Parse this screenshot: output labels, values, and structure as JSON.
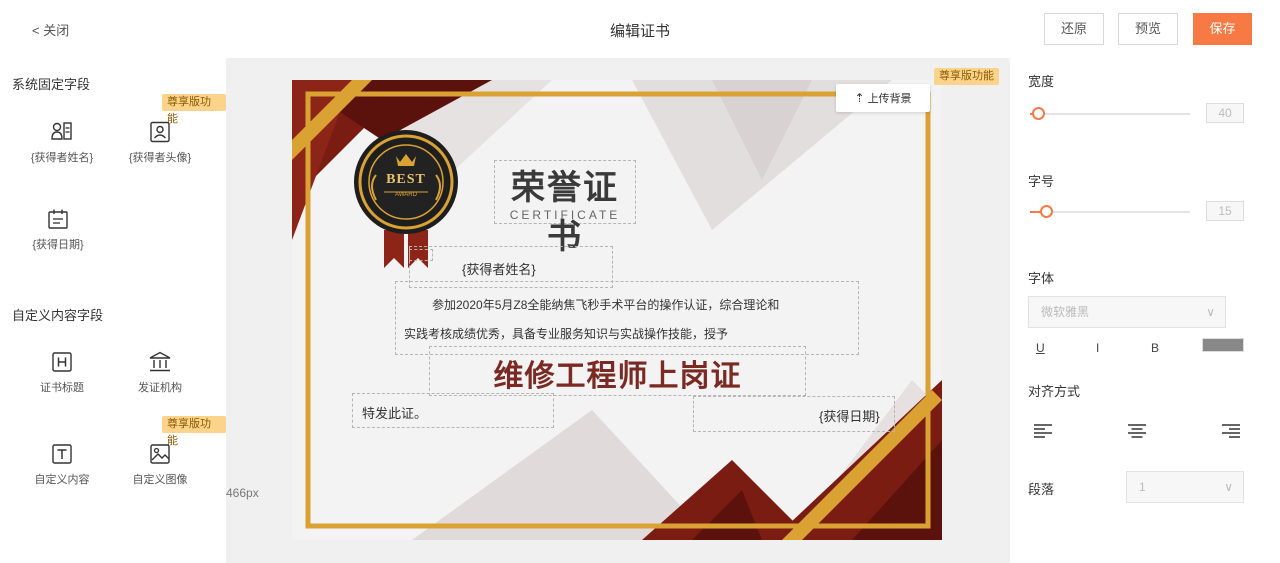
{
  "topbar": {
    "back_label": "< 关闭",
    "title": "编辑证书",
    "restore_label": "还原",
    "preview_label": "预览",
    "save_label": "保存"
  },
  "left_panel": {
    "fixed_section_title": "系统固定字段",
    "premium_badge": "尊享版功能",
    "fixed_fields": [
      {
        "label": "{获得者姓名}",
        "icon": "person-card-icon"
      },
      {
        "label": "{获得者头像}",
        "icon": "portrait-icon"
      },
      {
        "label": "{获得日期}",
        "icon": "calendar-icon"
      }
    ],
    "custom_section_title": "自定义内容字段",
    "custom_fields": [
      {
        "label": "证书标题",
        "icon": "heading-icon"
      },
      {
        "label": "发证机构",
        "icon": "institution-icon"
      },
      {
        "label": "自定义内容",
        "icon": "text-icon"
      },
      {
        "label": "自定义图像",
        "icon": "image-icon"
      }
    ]
  },
  "canvas": {
    "size_label": "466px",
    "premium_badge": "尊享版功能",
    "upload_bg_label": "上传背景",
    "certificate": {
      "badge_main": "BEST",
      "badge_sub": "AWARD",
      "title": "荣誉证书",
      "subtitle": "CERTIFICATE",
      "name_placeholder": "{获得者姓名}",
      "body_line1": "参加2020年5月Z8全能纳焦飞秒手术平台的操作认证，综合理论和",
      "body_line2": "实践考核成绩优秀，具备专业服务知识与实战操作技能，授予",
      "award_title": "维修工程师上岗证",
      "closing": "特发此证。",
      "date_placeholder": "{获得日期}"
    },
    "colors": {
      "dark_red": "#7a1c12",
      "gold": "#d9a233",
      "accent": "#f77a44"
    }
  },
  "right_panel": {
    "width_label": "宽度",
    "width_value": "40",
    "width_level": 0.05,
    "fontsize_label": "字号",
    "fontsize_value": "15",
    "fontsize_level": 0.1,
    "font_label": "字体",
    "font_value": "微软雅黑",
    "underline_label": "U",
    "italic_label": "I",
    "bold_label": "B",
    "text_color": "#888888",
    "align_label": "对齐方式",
    "paragraph_label": "段落",
    "paragraph_value": "1"
  }
}
